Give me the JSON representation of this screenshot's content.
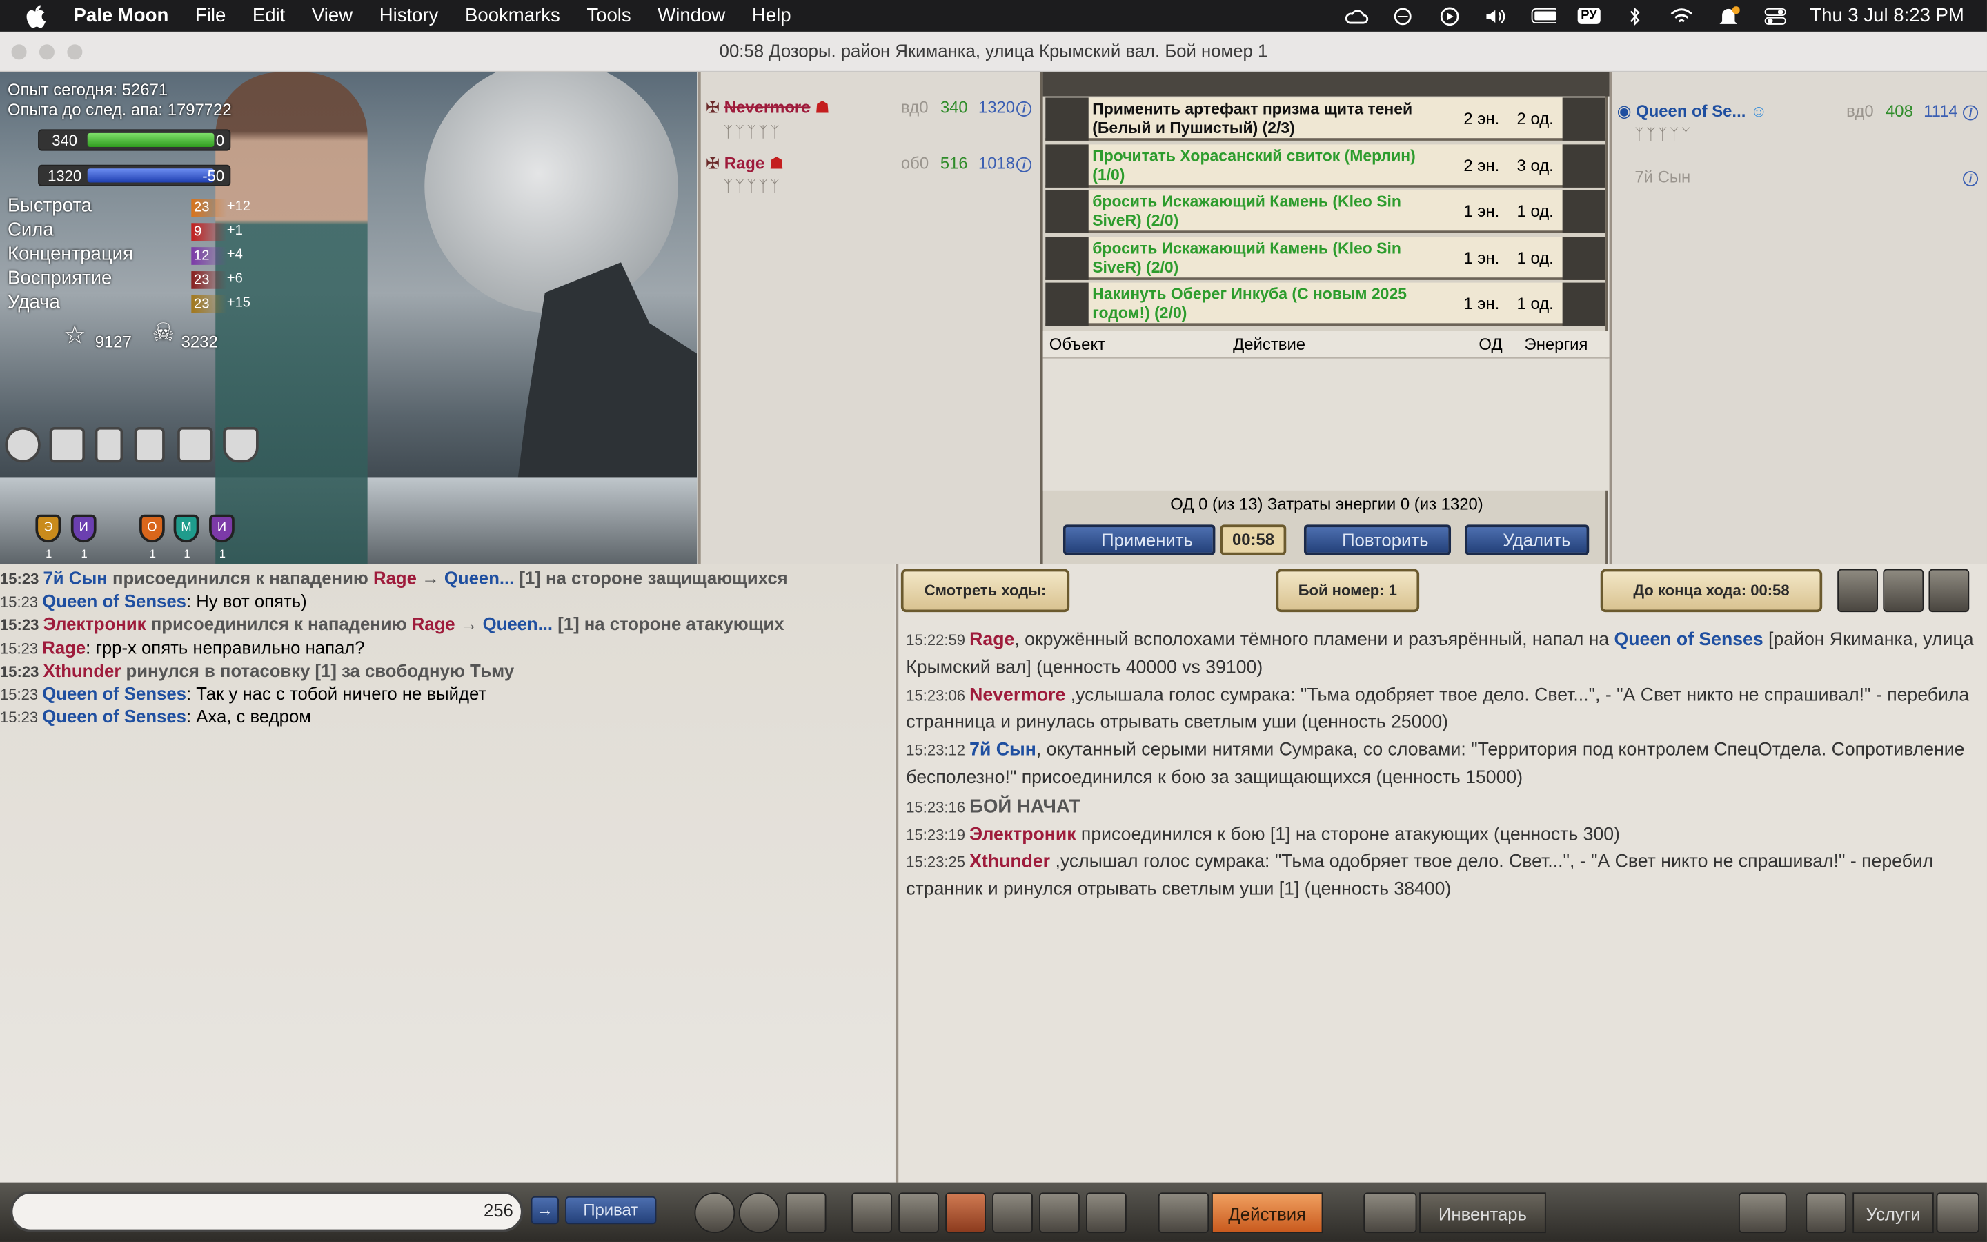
{
  "menubar": {
    "app": "Pale Moon",
    "items": [
      "File",
      "Edit",
      "View",
      "History",
      "Bookmarks",
      "Tools",
      "Window",
      "Help"
    ],
    "clock": "Thu 3 Jul  8:23 PM",
    "lang": "РУ"
  },
  "window": {
    "title": "00:58 Дозоры. район Якиманка, улица Крымский вал. Бой номер 1"
  },
  "character": {
    "exp_today": "Опыт сегодня: 52671",
    "exp_next": "Опыта до след. апа: 1797722",
    "hp": "340",
    "hp_right": "0",
    "hp_level": 1.0,
    "energy": "1320",
    "energy_right": "-50",
    "energy_level": 1.0,
    "stats": [
      {
        "name": "Быстрота",
        "value": "23",
        "bonus": "+12",
        "color": "#d9741c"
      },
      {
        "name": "Сила",
        "value": "9",
        "bonus": "+1",
        "color": "#c41e1e"
      },
      {
        "name": "Концентрация",
        "value": "12",
        "bonus": "+4",
        "color": "#7c3aa8"
      },
      {
        "name": "Восприятие",
        "value": "23",
        "bonus": "+6",
        "color": "#8a1e1e"
      },
      {
        "name": "Удача",
        "value": "23",
        "bonus": "+15",
        "color": "#a3781c"
      }
    ],
    "stars": "9127",
    "skulls": "3232",
    "shields": [
      {
        "l": "Э",
        "n": "1",
        "c": "#c98b1c"
      },
      {
        "l": "И",
        "n": "1",
        "c": "#6b3fb0"
      },
      {
        "l": "О",
        "n": "1",
        "c": "#d9661c"
      },
      {
        "l": "М",
        "n": "1",
        "c": "#1f9c8c"
      },
      {
        "l": "И",
        "n": "1",
        "c": "#7c3aa8"
      }
    ],
    "squares": [
      "49650",
      "8",
      "14",
      "8",
      "4"
    ]
  },
  "attackers": [
    {
      "name": "Nevermore",
      "pos": "вд0",
      "hp": "340",
      "en": "1320"
    },
    {
      "name": "Rage",
      "pos": "об0",
      "hp": "516",
      "en": "1018"
    }
  ],
  "actions": {
    "rows": [
      {
        "text": "Применить артефакт призма щита теней (Белый и Пушистый) (2/3)",
        "en": "2 эн.",
        "od": "2 од.",
        "color": "#111"
      },
      {
        "text": "Прочитать Хорасанский свиток (Мерлин) (1/0)",
        "en": "2 эн.",
        "od": "3 од.",
        "color": "#2d9c2d"
      },
      {
        "text": "бросить Искажающий Камень (Kleo Sin SiveR) (2/0)",
        "en": "1 эн.",
        "od": "1 од.",
        "color": "#2d9c2d"
      },
      {
        "text": "бросить Искажающий Камень (Kleo Sin SiveR) (2/0)",
        "en": "1 эн.",
        "od": "1 од.",
        "color": "#2d9c2d"
      },
      {
        "text": "Накинуть Оберег Инкуба (С новым 2025 годом!) (2/0)",
        "en": "1 эн.",
        "od": "1 од.",
        "color": "#2d9c2d"
      }
    ],
    "headers": {
      "object": "Объект",
      "action": "Действие",
      "od": "ОД",
      "energy": "Энергия"
    },
    "summary": "ОД 0 (из 13) Затраты энергии 0 (из 1320)",
    "apply": "Применить",
    "timer": "00:58",
    "repeat": "Повторить",
    "delete": "Удалить"
  },
  "defenders": [
    {
      "name": "Queen of Se...",
      "pos": "вд0",
      "hp": "408",
      "en": "1114"
    },
    {
      "name": "7й Сын"
    }
  ],
  "chat": [
    {
      "time": "15:23",
      "bold": true,
      "parts": [
        [
          "7й Сын",
          "blue"
        ],
        [
          " присоединился к нападению ",
          ""
        ],
        [
          "Rage",
          "red"
        ],
        [
          " → ",
          ""
        ],
        [
          "Queen...",
          "blue"
        ],
        [
          " [1] на стороне защищающихся",
          ""
        ]
      ]
    },
    {
      "time": "15:23",
      "bold": false,
      "parts": [
        [
          "Queen of Senses",
          "blue"
        ],
        [
          ":  Ну вот опять)",
          ""
        ]
      ]
    },
    {
      "time": "15:23",
      "bold": true,
      "parts": [
        [
          "Электроник",
          "red"
        ],
        [
          " присоединился к нападению ",
          ""
        ],
        [
          "Rage",
          "red"
        ],
        [
          " → ",
          ""
        ],
        [
          "Queen...",
          "blue"
        ],
        [
          " [1] на стороне атакующих",
          ""
        ]
      ]
    },
    {
      "time": "15:23",
      "bold": false,
      "parts": [
        [
          "Rage",
          "red"
        ],
        [
          ":  грр-х опять неправильно напал?",
          ""
        ]
      ]
    },
    {
      "time": "15:23",
      "bold": true,
      "parts": [
        [
          "Xthunder",
          "red"
        ],
        [
          " ринулся в потасовку [1] за свободную Тьму",
          ""
        ]
      ]
    },
    {
      "time": "15:23",
      "bold": false,
      "parts": [
        [
          "Queen of Senses",
          "blue"
        ],
        [
          ":  Так у нас с тобой ничего не выйдет",
          ""
        ]
      ]
    },
    {
      "time": "15:23",
      "bold": false,
      "parts": [
        [
          "Queen of Senses",
          "blue"
        ],
        [
          ":  Аха, с ведром",
          ""
        ]
      ]
    }
  ],
  "battle": {
    "watch": "Смотреть ходы:",
    "number": "Бой номер: 1",
    "turn_end": "До конца хода: 00:58",
    "log": [
      {
        "t": "15:22:59",
        "parts": [
          [
            "Rage",
            "red"
          ],
          [
            ", окружённый всполохами тёмного пламени и разъярённый, напал на ",
            ""
          ],
          [
            "Queen of Senses",
            "blue"
          ],
          [
            " [район Якиманка, улица Крымский вал] (ценность 40000 vs 39100)",
            ""
          ]
        ]
      },
      {
        "t": "15:23:06",
        "parts": [
          [
            "Nevermore",
            "red"
          ],
          [
            " ,услышала голос сумрака: \"Тьма одобряет твое дело. Свет...\", - \"А Свет никто не спрашивал!\" - перебила странница и ринулась отрывать светлым уши (ценность 25000)",
            ""
          ]
        ]
      },
      {
        "t": "15:23:12",
        "parts": [
          [
            "7й Сын",
            "blue"
          ],
          [
            ", окутанный серыми нитями Сумрака, со словами: \"Территория под контролем СпецОтдела. Сопротивление бесполезно!\" присоединился к бою за защищающихся (ценность 15000)",
            ""
          ]
        ]
      },
      {
        "t": "15:23:16",
        "parts": [
          [
            "БОЙ НАЧАТ",
            "start"
          ]
        ]
      },
      {
        "t": "15:23:19",
        "parts": [
          [
            "Электроник",
            "red"
          ],
          [
            " присоединился к бою [1] на стороне атакующих (ценность 300)",
            ""
          ]
        ]
      },
      {
        "t": "15:23:25",
        "parts": [
          [
            "Xthunder",
            "red"
          ],
          [
            " ,услышал голос сумрака: \"Тьма одобряет твое дело. Свет...\", - \"А Свет никто не спрашивал!\" - перебил странник и ринулся отрывать светлым уши [1] (ценность 38400)",
            ""
          ]
        ]
      }
    ]
  },
  "bottom": {
    "counter": "256",
    "private": "Приват",
    "actions": "Действия",
    "inventory": "Инвентарь",
    "services": "Услуги"
  }
}
